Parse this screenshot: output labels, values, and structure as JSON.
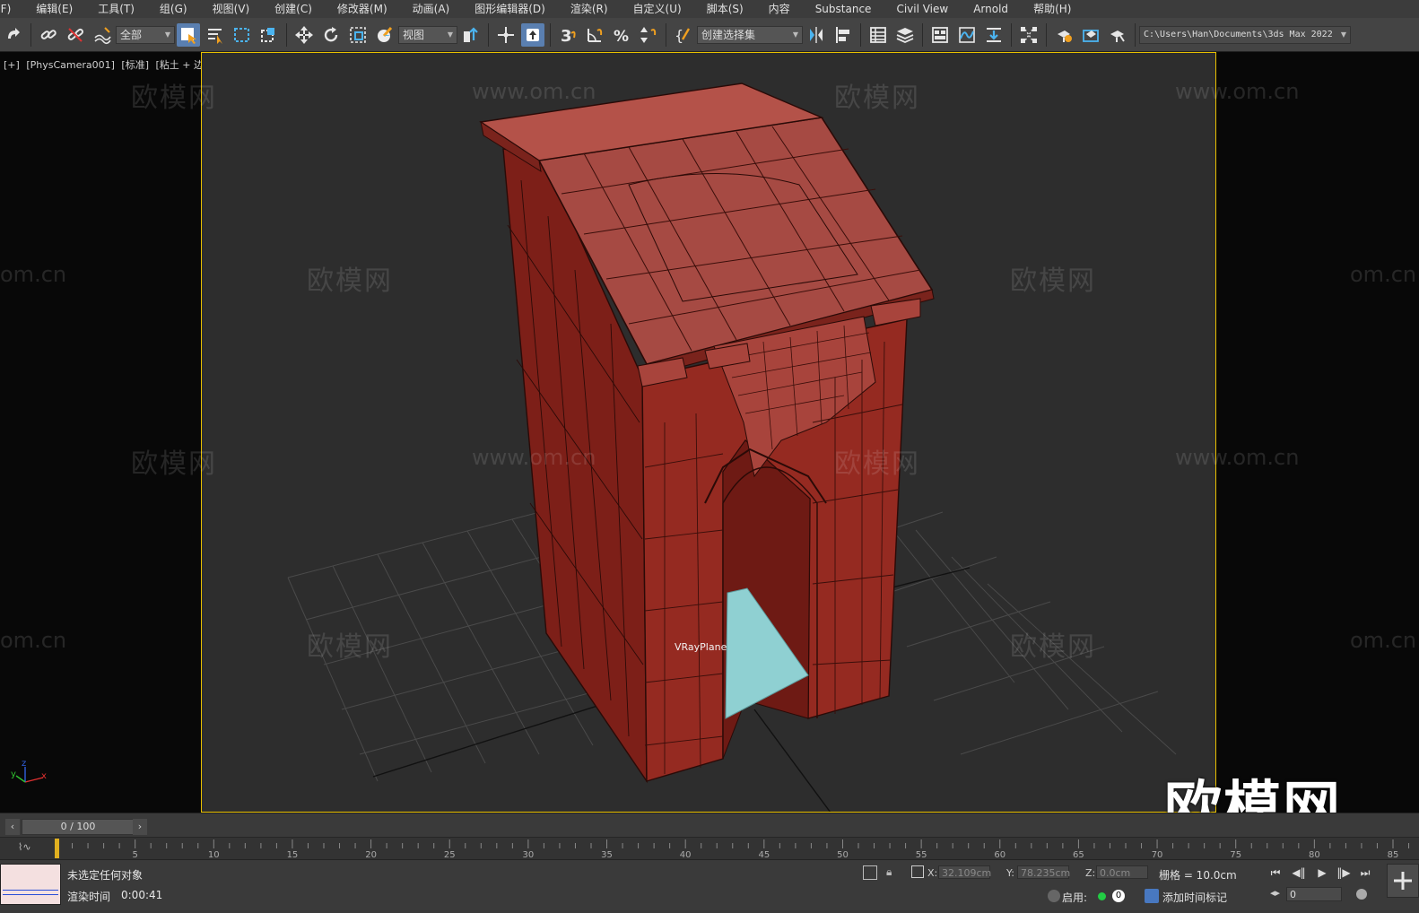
{
  "menu": [
    "(F)",
    "编辑(E)",
    "工具(T)",
    "组(G)",
    "视图(V)",
    "创建(C)",
    "修改器(M)",
    "动画(A)",
    "图形编辑器(D)",
    "渲染(R)",
    "自定义(U)",
    "脚本(S)",
    "内容",
    "Substance",
    "Civil View",
    "Arnold",
    "帮助(H)"
  ],
  "toolbar": {
    "filter_value": "全部",
    "ref_coord_value": "视图",
    "selection_set_placeholder": "创建选择集",
    "snap_number": "3",
    "path": "C:\\Users\\Han\\Documents\\3ds Max 2022"
  },
  "viewport": {
    "labels": [
      "[+]",
      "[PhysCamera001]",
      "[标准]",
      "[粘土 + 边面]"
    ],
    "object_label": "VRayPlane",
    "axis_labels": {
      "x": "x",
      "y": "y",
      "z": "z"
    }
  },
  "watermarks": {
    "cn": "欧模网",
    "en": "www.om.cn",
    "en_partial": "om.cn",
    "big_logo": "欧模网"
  },
  "timeline": {
    "slider_text": "0 / 100",
    "current_frame": 0,
    "total_frames": 100,
    "ticks": [
      "5",
      "10",
      "15",
      "20",
      "25",
      "30",
      "35",
      "40",
      "45",
      "50",
      "55",
      "60",
      "65",
      "70",
      "75",
      "80",
      "85"
    ]
  },
  "status": {
    "selection_text": "未选定任何对象",
    "render_label": "渲染时间",
    "render_value": "0:00:41",
    "x_label": "X:",
    "x_value": "32.109cm",
    "y_label": "Y:",
    "y_value": "78.235cm",
    "z_label": "Z:",
    "z_value": "0.0cm",
    "grid_text": "栅格 = 10.0cm",
    "enable_label": "启用:",
    "zero_text": "0",
    "add_key_label": "添加时间标记",
    "frame_value": "0"
  },
  "colors": {
    "viewport_border": "#e8c000",
    "model": "#9a2e26",
    "plane": "#8fd0d2",
    "active_button": "#5a7fb0"
  }
}
